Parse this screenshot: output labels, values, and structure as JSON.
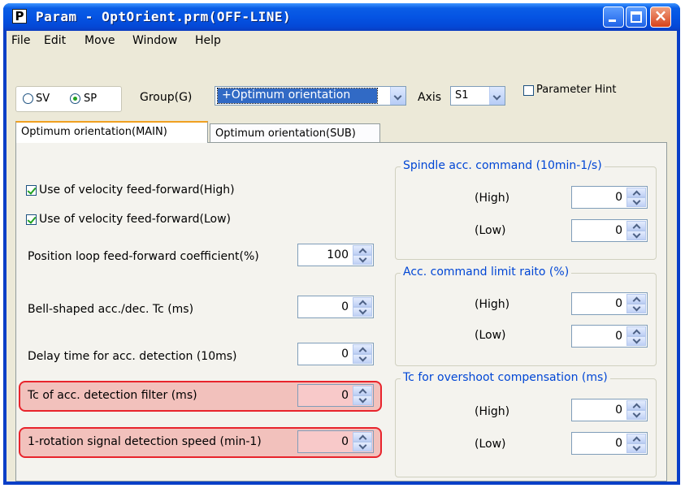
{
  "window": {
    "title": "Param - OptOrient.prm(OFF-LINE)",
    "app_icon_letter": "P",
    "titlebar_color": "#0554e3",
    "close_button_color": "#d7421a"
  },
  "menu": [
    "File",
    "Edit",
    "Move",
    "Window",
    "Help"
  ],
  "controls": {
    "radio_sv": "SV",
    "radio_sp": "SP",
    "radio_selected": "SP",
    "group_label": "Group(G)",
    "group_value": "+Optimum orientation",
    "axis_label": "Axis",
    "axis_value": "S1",
    "hint_label": "Parameter Hint",
    "hint_checked": false
  },
  "tabs": [
    {
      "label": "Optimum orientation(MAIN)",
      "active": true
    },
    {
      "label": "Optimum orientation(SUB)",
      "active": false
    }
  ],
  "left": {
    "checkboxes": [
      {
        "label": "Use of velocity feed-forward(High)",
        "checked": true
      },
      {
        "label": "Use of velocity feed-forward(Low)",
        "checked": true
      }
    ],
    "fields": [
      {
        "label": "Position loop feed-forward coefficient(%)",
        "value": "100",
        "highlighted": false
      },
      {
        "label": "Bell-shaped acc./dec. Tc (ms)",
        "value": "0",
        "highlighted": false
      },
      {
        "label": "Delay time for acc. detection (10ms)",
        "value": "0",
        "highlighted": false
      },
      {
        "label": "Tc of acc. detection filter (ms)",
        "value": "0",
        "highlighted": true
      },
      {
        "label": "1-rotation signal detection speed (min-1)",
        "value": "0",
        "highlighted": true
      }
    ],
    "highlight_color": "#e8242c"
  },
  "groups": [
    {
      "title": "Spindle acc. command (10min-1/s)",
      "rows": [
        {
          "label": "(High)",
          "value": "0"
        },
        {
          "label": "(Low)",
          "value": "0"
        }
      ]
    },
    {
      "title": "Acc. command limit raito (%)",
      "rows": [
        {
          "label": "(High)",
          "value": "0"
        },
        {
          "label": "(Low)",
          "value": "0"
        }
      ]
    },
    {
      "title": "Tc for overshoot compensation (ms)",
      "rows": [
        {
          "label": "(High)",
          "value": "0"
        },
        {
          "label": "(Low)",
          "value": "0"
        }
      ]
    }
  ],
  "accent_color": "#0046d5"
}
